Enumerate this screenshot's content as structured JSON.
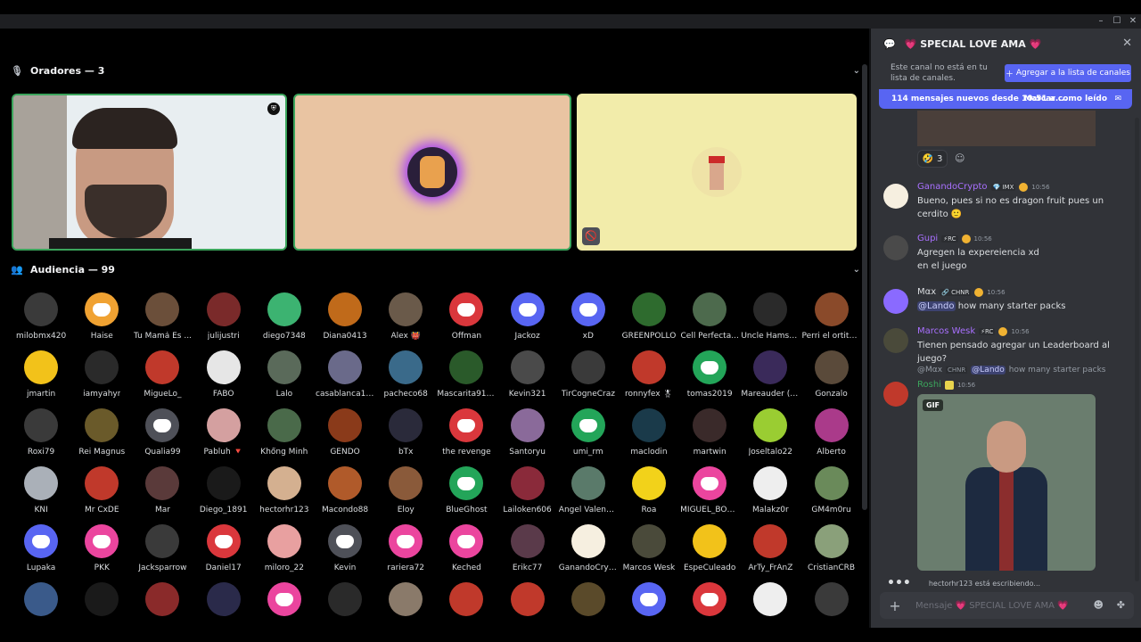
{
  "window": {
    "minimize": "–",
    "maximize": "☐",
    "close": "✕"
  },
  "stage": {
    "speakers_label": "Oradores — 3",
    "audience_label": "Audiencia — 99"
  },
  "audience": [
    {
      "name": "milobmx420",
      "color": "#3a3a3a"
    },
    {
      "name": "Haise",
      "color": "#f0a232",
      "dc": true
    },
    {
      "name": "Tu Mamá Es ...",
      "color": "#6b4f3a"
    },
    {
      "name": "julijustri",
      "color": "#7a2a2a"
    },
    {
      "name": "diego7348",
      "color": "#3cb371"
    },
    {
      "name": "Diana0413",
      "color": "#c06a1a"
    },
    {
      "name": "Alex 👹",
      "color": "#6a5a4a"
    },
    {
      "name": "Offman",
      "color": "#da373c",
      "dc": true
    },
    {
      "name": "Jackoz",
      "color": "#5865f2",
      "dc": true
    },
    {
      "name": "xD",
      "color": "#5865f2",
      "dc": true
    },
    {
      "name": "GREENPOLLO",
      "color": "#2e6b2e"
    },
    {
      "name": "Cell Perfecta...",
      "color": "#4d6a4d"
    },
    {
      "name": "Uncle Hamster",
      "color": "#2a2a2a"
    },
    {
      "name": "Perri el ortito ...",
      "color": "#8a4a2a"
    },
    {
      "name": "jmartin",
      "color": "#f2c21a"
    },
    {
      "name": "iamyahyr",
      "color": "#2a2a2a"
    },
    {
      "name": "MigueLo_",
      "color": "#c0392b"
    },
    {
      "name": "FABO",
      "color": "#e6e6e6"
    },
    {
      "name": "Lalo",
      "color": "#5a6a5a"
    },
    {
      "name": "casablanca1150",
      "color": "#6a6a8a"
    },
    {
      "name": "pacheco68",
      "color": "#3a6a8a"
    },
    {
      "name": "Mascarita9126",
      "color": "#2a5a2a"
    },
    {
      "name": "Kevin321",
      "color": "#4a4a4a"
    },
    {
      "name": "TirCogneCraz",
      "color": "#3a3a3a"
    },
    {
      "name": "ronnyfex 🎖",
      "color": "#c0392b"
    },
    {
      "name": "tomas2019",
      "color": "#23a559",
      "dc": true
    },
    {
      "name": "Mareauder (F...",
      "color": "#3a2a5a"
    },
    {
      "name": "Gonzalo",
      "color": "#5a4a3a"
    },
    {
      "name": "Roxi79",
      "color": "#3a3a3a"
    },
    {
      "name": "Rei Magnus",
      "color": "#6a5a2a"
    },
    {
      "name": "Qualia99",
      "color": "#4e5058",
      "dc": true
    },
    {
      "name": "Pabluh 🔻",
      "color": "#d4a0a0"
    },
    {
      "name": "Khổng Minh",
      "color": "#4a6a4a"
    },
    {
      "name": "GENDO",
      "color": "#8a3a1a"
    },
    {
      "name": "bTx",
      "color": "#2a2a3a"
    },
    {
      "name": "the revenge",
      "color": "#da373c",
      "dc": true
    },
    {
      "name": "Santoryu",
      "color": "#8a6a9a"
    },
    {
      "name": "umi_rm",
      "color": "#23a559",
      "dc": true
    },
    {
      "name": "maclodin",
      "color": "#1a3a4a"
    },
    {
      "name": "martwin",
      "color": "#3a2a2a"
    },
    {
      "name": "Joseltalo22",
      "color": "#9acd32"
    },
    {
      "name": "Alberto",
      "color": "#aa3a8a"
    },
    {
      "name": "KNI",
      "color": "#aab0b8"
    },
    {
      "name": "Mr CxDE",
      "color": "#c0392b"
    },
    {
      "name": "Mar",
      "color": "#5a3a3a"
    },
    {
      "name": "Diego_1891",
      "color": "#1a1a1a"
    },
    {
      "name": "hectorhr123",
      "color": "#d4b090"
    },
    {
      "name": "Macondo88",
      "color": "#b05a2a"
    },
    {
      "name": "Eloy",
      "color": "#8a5a3a"
    },
    {
      "name": "BlueGhost",
      "color": "#23a559",
      "dc": true
    },
    {
      "name": "Lailoken606",
      "color": "#8a2a3a"
    },
    {
      "name": "Ángel Valencia",
      "color": "#5a7a6a"
    },
    {
      "name": "Roa",
      "color": "#f2d21a"
    },
    {
      "name": "MIGUEL_BON...",
      "color": "#eb459e",
      "dc": true
    },
    {
      "name": "Malakz0r",
      "color": "#eeeeee"
    },
    {
      "name": "GM4m0ru",
      "color": "#6a8a5a"
    },
    {
      "name": "Lupaka",
      "color": "#5865f2",
      "dc": true
    },
    {
      "name": "PKK",
      "color": "#eb459e",
      "dc": true
    },
    {
      "name": "Jacksparrow",
      "color": "#3a3a3a"
    },
    {
      "name": "Daniel17",
      "color": "#da373c",
      "dc": true
    },
    {
      "name": "miloro_22",
      "color": "#e8a0a0"
    },
    {
      "name": "Kevin",
      "color": "#4e5058",
      "dc": true
    },
    {
      "name": "rariera72",
      "color": "#eb459e",
      "dc": true
    },
    {
      "name": "Keched",
      "color": "#eb459e",
      "dc": true
    },
    {
      "name": "Erikc77",
      "color": "#5a3a4a"
    },
    {
      "name": "GanandoCryp...",
      "color": "#f6efe0"
    },
    {
      "name": "Marcos Wesk",
      "color": "#4a4a3a"
    },
    {
      "name": "EspeCuleado",
      "color": "#f2c21a"
    },
    {
      "name": "ArTy_FrAnZ",
      "color": "#c0392b"
    },
    {
      "name": "CristianCRB",
      "color": "#8aa07a"
    },
    {
      "name": "",
      "color": "#3a5a8a"
    },
    {
      "name": "",
      "color": "#1a1a1a"
    },
    {
      "name": "",
      "color": "#8a2a2a"
    },
    {
      "name": "",
      "color": "#2a2a4a"
    },
    {
      "name": "",
      "color": "#eb459e",
      "dc": true
    },
    {
      "name": "",
      "color": "#2a2a2a"
    },
    {
      "name": "",
      "color": "#8a7a6a"
    },
    {
      "name": "",
      "color": "#c0392b"
    },
    {
      "name": "",
      "color": "#c0392b"
    },
    {
      "name": "",
      "color": "#5a4a2a"
    },
    {
      "name": "",
      "color": "#5865f2",
      "dc": true
    },
    {
      "name": "",
      "color": "#da373c",
      "dc": true
    },
    {
      "name": "",
      "color": "#eeeeee"
    },
    {
      "name": "",
      "color": "#3a3a3a"
    }
  ],
  "chat": {
    "title": "💗 SPECIAL LOVE AMA 💗",
    "notice": "Este canal no está en tu lista de canales.",
    "add_button": "Agregar a la lista de canales",
    "new_messages": "114 mensajes nuevos desde 10:51 a....",
    "mark_read": "Marcar como leído",
    "reaction": {
      "emoji": "🤣",
      "count": "3"
    },
    "messages": [
      {
        "user": "GanandoCrypto",
        "user_color": "#a970ff",
        "tag": "💎 IMX",
        "time": "10:56",
        "body": "Bueno, pues si no es dragon fruit pues un cerdito 🙂",
        "avatar_color": "#f6efe0"
      },
      {
        "user": "Gupi",
        "user_color": "#a970ff",
        "tag": "⚡RC",
        "time": "10:56",
        "body": "Agregen la expereiencia xd",
        "body2": "en el juego",
        "avatar_color": "#4a4a4a"
      },
      {
        "user": "Mαx",
        "user_color": "#dbdee1",
        "tag": "🔗 CHNR",
        "time": "10:56",
        "mention": "@Lando",
        "body": " how many starter packs",
        "avatar_color": "#8a6aff"
      },
      {
        "user": "Marcos Wesk",
        "user_color": "#a970ff",
        "tag": "⚡RC",
        "time": "10:56",
        "body": "Tienen pensado agregar un Leaderboard al juego?",
        "avatar_color": "#4a4a3a"
      }
    ],
    "reply": {
      "user": "@Mαx",
      "tag": "CHNR",
      "mention": "@Lando",
      "text": " how many starter packs"
    },
    "last_message": {
      "user": "Roshi",
      "user_color": "#3ba55c",
      "time": "10:56",
      "avatar_color": "#c0392b"
    },
    "gif_label": "GIF",
    "typing": "hectorhr123 está escribiendo...",
    "composer_placeholder": "Mensaje 💗 SPECIAL LOVE AMA 💗"
  }
}
